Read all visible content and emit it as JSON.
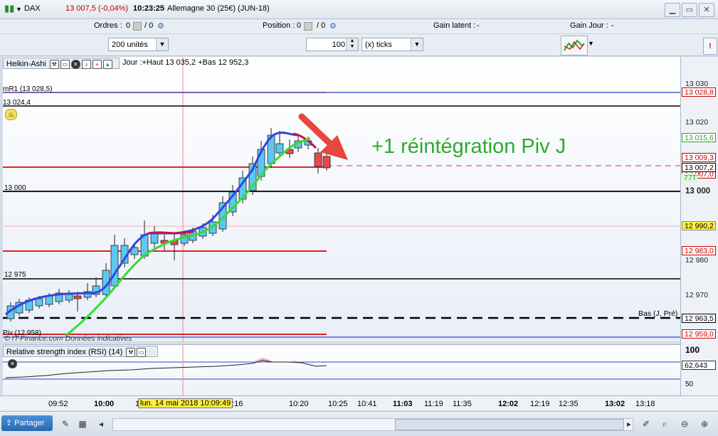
{
  "titlebar": {
    "symbol": "DAX",
    "price_change": "13 007,5 (-0,04%)",
    "time": "10:23:25",
    "instrument": "Allemagne 30 (25€) (JUN-18)"
  },
  "infobar": {
    "orders_label": "Ordres :",
    "orders_value": "0",
    "orders_total": "/ 0",
    "position_label": "Position :",
    "position_value": "0",
    "position_total": "/ 0",
    "gain_latent_label": "Gain latent :",
    "gain_latent_value": "-",
    "gain_jour_label": "Gain Jour :",
    "gain_jour_value": "-"
  },
  "toolbar": {
    "units_select": "200 unités",
    "ticks_value": "100",
    "ticks_select": "(x) ticks"
  },
  "chart_header": {
    "tab_label": "Heikin-Ashi",
    "range_text": "Jour :+Haut 13 035,2 +Bas 12 952,3"
  },
  "chart_labels": {
    "mr1": "mR1 (13 028,5)",
    "level_13024": "13 024,4",
    "level_13000": "13 000",
    "level_12975": "12 975",
    "piv": "Piv (12 958)",
    "watermark": "© IT-Finance.com Données indicatives",
    "bas": "Bas (J, Pré)",
    "annotation": "+1 réintégration Piv J",
    "crosshair_date": "lun. 14 mai 2018 10:09:49"
  },
  "price_axis": {
    "ticks": [
      "13 030",
      "13 020",
      "13 000",
      "12 980",
      "12 970"
    ],
    "tags": [
      {
        "text": "13 028,8",
        "color": "#cc0000"
      },
      {
        "text": "13 015,6",
        "color": "#22aa22"
      },
      {
        "text": "13 009,3",
        "color": "#cc0000"
      },
      {
        "text": "13 007,2",
        "color": "#000000"
      },
      {
        "text": "13 007,0",
        "color": "#cc0000"
      },
      {
        "text": "77T",
        "color": "#22aa22"
      },
      {
        "text": "12 990,2",
        "color": "#000000"
      },
      {
        "text": "12 983,0",
        "color": "#cc0000"
      },
      {
        "text": "12 963,5",
        "color": "#000000"
      },
      {
        "text": "12 959,0",
        "color": "#cc0000"
      }
    ]
  },
  "rsi": {
    "label": "Relative strength index (RSI) (14)",
    "value": "62,643",
    "tick_100": "100",
    "tick_50": "50"
  },
  "time_axis": [
    "09:52",
    "10:00",
    "1",
    "0:16",
    "10:20",
    "10:25",
    "10:41",
    "11:03",
    "11:19",
    "11:35",
    "12:02",
    "12:19",
    "12:35",
    "13:02",
    "13:18"
  ],
  "statusbar": {
    "share_button": "Partager"
  },
  "colors": {
    "bull_candle": "#5bc8f0",
    "bear_candle": "#e84a4a",
    "ma_blue": "#3344dd",
    "ma_red": "#cc1144",
    "ma_green": "#33dd33",
    "annotation": "#2eaa2e",
    "arrow": "#e8463e"
  }
}
